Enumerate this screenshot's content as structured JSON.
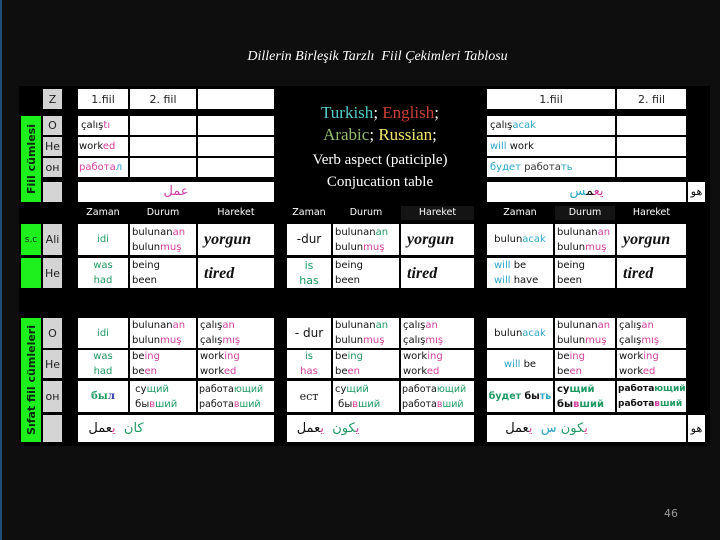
{
  "slide": {
    "title": "Dillerin Birleşik Tarzlı  Fiil Çekimleri Tablosu",
    "page_number": "46"
  },
  "colors": {
    "dark": "#111111",
    "gray": "#333333",
    "pink": "#d33f9e",
    "teal": "#2ea6c9",
    "green": "#1f9a62",
    "blue": "#2535a8",
    "white": "#ffffff",
    "turkish": "#52cccc",
    "english": "#cc4136",
    "arabic": "#94bd6c",
    "russian": "#f3e46c",
    "label_green": "#1ef01e",
    "label_gray": "#d4d4d4"
  },
  "side_labels": {
    "fiil_cumlesi": "Fiil cümlesi",
    "sc": "s.c",
    "sifat_fiil": "Sıfat fiil cümleleri"
  },
  "pronouns": {
    "header": "Z",
    "finite": [
      "O",
      "He",
      "он",
      ""
    ],
    "adjectival": [
      "Ali",
      "He"
    ],
    "participle": [
      "O",
      "He",
      "он",
      ""
    ]
  },
  "legend": {
    "line1": [
      [
        {
          "t": "Turkish",
          "c": "turkish"
        },
        {
          "t": "; ",
          "c": "white"
        },
        {
          "t": "English",
          "c": "english"
        },
        {
          "t": ";",
          "c": "white"
        }
      ]
    ],
    "line2": [
      [
        {
          "t": "Arabic",
          "c": "arabic"
        },
        {
          "t": "; ",
          "c": "white"
        },
        {
          "t": "Russian",
          "c": "russian"
        },
        {
          "t": ";",
          "c": "white"
        }
      ]
    ],
    "line3": "Verb aspect (paticiple)",
    "line4": "Conjucation table"
  },
  "finite": {
    "past": {
      "headers": [
        "1.fiil",
        "2. fiil"
      ],
      "rows": [
        [
          [
            {
              "t": "çalış",
              "c": "dark"
            },
            {
              "t": "tı",
              "c": "pink"
            }
          ]
        ],
        [
          [
            {
              "t": "work",
              "c": "dark"
            },
            {
              "t": "ed",
              "c": "pink"
            }
          ]
        ],
        [
          [
            {
              "t": "работа",
              "c": "pink"
            },
            {
              "t": "л",
              "c": "teal"
            }
          ]
        ]
      ],
      "arabic": [
        [
          {
            "t": "عمل",
            "c": "pink"
          }
        ]
      ]
    },
    "future": {
      "headers": [
        "1.fiil",
        "2. fiil"
      ],
      "rows": [
        [
          [
            {
              "t": "çalış",
              "c": "dark"
            },
            {
              "t": "acak",
              "c": "teal"
            }
          ]
        ],
        [
          [
            {
              "t": "will",
              "c": "teal"
            },
            {
              "t": " work",
              "c": "dark"
            }
          ]
        ],
        [
          [
            {
              "t": "будет",
              "c": "teal"
            },
            {
              "t": " работа",
              "c": "gray"
            },
            {
              "t": "ть",
              "c": "teal"
            }
          ]
        ]
      ],
      "arabic": [
        [
          {
            "t": "يع",
            "c": "pink"
          },
          {
            "t": "م",
            "c": "dark"
          },
          {
            "t": "س",
            "c": "teal"
          }
        ]
      ],
      "pronoun_ar": "هو"
    }
  },
  "column_headers": [
    "Zaman",
    "Durum",
    "Hareket"
  ],
  "adjectival": {
    "past": [
      {
        "zaman": [
          [
            {
              "t": "idi",
              "c": "green"
            }
          ]
        ],
        "durum": [
          [
            {
              "t": "bulunan",
              "c": "dark"
            },
            {
              "t": "an",
              "c": "pink"
            }
          ],
          [
            {
              "t": "bulun",
              "c": "dark"
            },
            {
              "t": "muş",
              "c": "pink"
            }
          ]
        ],
        "hareket": [
          [
            {
              "t": "yorgun",
              "c": "dark"
            }
          ]
        ]
      },
      {
        "zaman": [
          [
            {
              "t": "was",
              "c": "green"
            }
          ],
          [
            {
              "t": "had",
              "c": "green"
            }
          ]
        ],
        "durum": [
          [
            {
              "t": "being",
              "c": "dark"
            }
          ],
          [
            {
              "t": "been",
              "c": "dark"
            }
          ]
        ],
        "hareket": [
          [
            {
              "t": "tired",
              "c": "dark"
            }
          ]
        ]
      }
    ],
    "present": [
      {
        "zaman": [
          [
            {
              "t": "-dur",
              "c": "dark"
            }
          ]
        ],
        "durum": [
          [
            {
              "t": "bulunan",
              "c": "dark"
            },
            {
              "t": "an",
              "c": "green"
            }
          ],
          [
            {
              "t": "bulun",
              "c": "dark"
            },
            {
              "t": "muş",
              "c": "pink"
            }
          ]
        ],
        "hareket": [
          [
            {
              "t": "yorgun",
              "c": "dark"
            }
          ]
        ]
      },
      {
        "zaman": [
          [
            {
              "t": "is",
              "c": "green"
            }
          ],
          [
            {
              "t": "has",
              "c": "green"
            }
          ]
        ],
        "durum": [
          [
            {
              "t": "being",
              "c": "dark"
            }
          ],
          [
            {
              "t": "been",
              "c": "dark"
            }
          ]
        ],
        "hareket": [
          [
            {
              "t": "tired",
              "c": "dark"
            }
          ]
        ]
      }
    ],
    "future": [
      {
        "zaman": [
          [
            {
              "t": "bulun",
              "c": "dark"
            },
            {
              "t": "acak",
              "c": "teal"
            }
          ]
        ],
        "durum": [
          [
            {
              "t": "bulunan",
              "c": "dark"
            },
            {
              "t": "an",
              "c": "pink"
            }
          ],
          [
            {
              "t": "bulun",
              "c": "dark"
            },
            {
              "t": "muş",
              "c": "pink"
            }
          ]
        ],
        "hareket": [
          [
            {
              "t": "yorgun",
              "c": "dark"
            }
          ]
        ]
      },
      {
        "zaman": [
          [
            {
              "t": "will",
              "c": "teal"
            },
            {
              "t": " be",
              "c": "dark"
            }
          ],
          [
            {
              "t": "will",
              "c": "teal"
            },
            {
              "t": " have",
              "c": "dark"
            }
          ]
        ],
        "durum": [
          [
            {
              "t": "being",
              "c": "dark"
            }
          ],
          [
            {
              "t": "been",
              "c": "dark"
            }
          ]
        ],
        "hareket": [
          [
            {
              "t": "tired",
              "c": "dark"
            }
          ]
        ]
      }
    ]
  },
  "participle": {
    "past": [
      {
        "zaman": [
          [
            {
              "t": "idi",
              "c": "green"
            }
          ]
        ],
        "durum": [
          [
            {
              "t": "bulunan",
              "c": "dark"
            },
            {
              "t": "an",
              "c": "pink"
            }
          ],
          [
            {
              "t": "bulun",
              "c": "dark"
            },
            {
              "t": "muş",
              "c": "pink"
            }
          ]
        ],
        "hareket": [
          [
            {
              "t": "çalış",
              "c": "dark"
            },
            {
              "t": "an",
              "c": "pink"
            }
          ],
          [
            {
              "t": "çalış",
              "c": "dark"
            },
            {
              "t": "mış",
              "c": "pink"
            }
          ]
        ]
      },
      {
        "zaman": [
          [
            {
              "t": "was",
              "c": "green"
            }
          ],
          [
            {
              "t": "had",
              "c": "green"
            }
          ]
        ],
        "durum": [
          [
            {
              "t": "be",
              "c": "dark"
            },
            {
              "t": "ing",
              "c": "pink"
            }
          ],
          [
            {
              "t": "be",
              "c": "dark"
            },
            {
              "t": "en",
              "c": "pink"
            }
          ]
        ],
        "hareket": [
          [
            {
              "t": "work",
              "c": "dark"
            },
            {
              "t": "ing",
              "c": "pink"
            }
          ],
          [
            {
              "t": "work",
              "c": "dark"
            },
            {
              "t": "ed",
              "c": "pink"
            }
          ]
        ]
      },
      {
        "zaman": [
          [
            {
              "t": "бы",
              "c": "green"
            },
            {
              "t": "л",
              "c": "blue"
            }
          ]
        ],
        "durum": [
          [
            {
              "t": " су",
              "c": "dark"
            },
            {
              "t": "щий",
              "c": "green"
            }
          ],
          [
            {
              "t": " бы",
              "c": "dark"
            },
            {
              "t": "в",
              "c": "pink"
            },
            {
              "t": "ший",
              "c": "green"
            }
          ]
        ],
        "hareket": [
          [
            {
              "t": "работа",
              "c": "dark"
            },
            {
              "t": "ющий",
              "c": "green"
            }
          ],
          [
            {
              "t": "работа",
              "c": "dark"
            },
            {
              "t": "в",
              "c": "pink"
            },
            {
              "t": "ший",
              "c": "green"
            }
          ]
        ]
      }
    ],
    "present": [
      {
        "zaman": [
          [
            {
              "t": "- dur",
              "c": "dark"
            }
          ]
        ],
        "durum": [
          [
            {
              "t": "bulunan",
              "c": "dark"
            },
            {
              "t": "an",
              "c": "green"
            }
          ],
          [
            {
              "t": "bulun",
              "c": "dark"
            },
            {
              "t": "muş",
              "c": "pink"
            }
          ]
        ],
        "hareket": [
          [
            {
              "t": "çalış",
              "c": "dark"
            },
            {
              "t": "an",
              "c": "pink"
            }
          ],
          [
            {
              "t": "çalış",
              "c": "dark"
            },
            {
              "t": "mış",
              "c": "pink"
            }
          ]
        ]
      },
      {
        "zaman": [
          [
            {
              "t": "is",
              "c": "green"
            }
          ],
          [
            {
              "t": "has",
              "c": "pink"
            }
          ]
        ],
        "durum": [
          [
            {
              "t": "be",
              "c": "dark"
            },
            {
              "t": "ing",
              "c": "green"
            }
          ],
          [
            {
              "t": "be",
              "c": "dark"
            },
            {
              "t": "en",
              "c": "pink"
            }
          ]
        ],
        "hareket": [
          [
            {
              "t": "work",
              "c": "dark"
            },
            {
              "t": "ing",
              "c": "pink"
            }
          ],
          [
            {
              "t": "work",
              "c": "dark"
            },
            {
              "t": "ed",
              "c": "pink"
            }
          ]
        ]
      },
      {
        "zaman": [
          [
            {
              "t": "ест",
              "c": "dark"
            }
          ]
        ],
        "durum": [
          [
            {
              "t": "су",
              "c": "dark"
            },
            {
              "t": "щий",
              "c": "green"
            }
          ],
          [
            {
              "t": " бы",
              "c": "dark"
            },
            {
              "t": "в",
              "c": "pink"
            },
            {
              "t": "ший",
              "c": "green"
            }
          ]
        ],
        "hareket": [
          [
            {
              "t": "работа",
              "c": "dark"
            },
            {
              "t": "ющий",
              "c": "green"
            }
          ],
          [
            {
              "t": "работа",
              "c": "dark"
            },
            {
              "t": "в",
              "c": "pink"
            },
            {
              "t": "ший",
              "c": "green"
            }
          ]
        ]
      }
    ],
    "future": [
      {
        "zaman": [
          [
            {
              "t": "bulun",
              "c": "dark"
            },
            {
              "t": "acak",
              "c": "teal"
            }
          ]
        ],
        "durum": [
          [
            {
              "t": "bulunan",
              "c": "dark"
            },
            {
              "t": "an",
              "c": "pink"
            }
          ],
          [
            {
              "t": "bulun",
              "c": "dark"
            },
            {
              "t": "muş",
              "c": "pink"
            }
          ]
        ],
        "hareket": [
          [
            {
              "t": "çalış",
              "c": "dark"
            },
            {
              "t": "an",
              "c": "pink"
            }
          ],
          [
            {
              "t": "çalış",
              "c": "dark"
            },
            {
              "t": "mış",
              "c": "pink"
            }
          ]
        ]
      },
      {
        "zaman": [
          [
            {
              "t": "will",
              "c": "teal"
            },
            {
              "t": " be",
              "c": "dark"
            }
          ]
        ],
        "durum": [
          [
            {
              "t": "be",
              "c": "dark"
            },
            {
              "t": "ing",
              "c": "pink"
            }
          ],
          [
            {
              "t": "be",
              "c": "dark"
            },
            {
              "t": "en",
              "c": "pink"
            }
          ]
        ],
        "hareket": [
          [
            {
              "t": "work",
              "c": "dark"
            },
            {
              "t": "ing",
              "c": "pink"
            }
          ],
          [
            {
              "t": "work",
              "c": "dark"
            },
            {
              "t": "ed",
              "c": "pink"
            }
          ]
        ]
      },
      {
        "zaman": [
          [
            {
              "t": "будет",
              "c": "green"
            },
            {
              "t": " бы",
              "c": "dark"
            },
            {
              "t": "ть",
              "c": "teal"
            }
          ]
        ],
        "durum": [
          [
            {
              "t": "су",
              "c": "dark"
            },
            {
              "t": "щий",
              "c": "green"
            }
          ],
          [
            {
              "t": "бы",
              "c": "dark"
            },
            {
              "t": "в",
              "c": "pink"
            },
            {
              "t": "ший",
              "c": "green"
            }
          ]
        ],
        "hareket": [
          [
            {
              "t": "работа",
              "c": "dark"
            },
            {
              "t": "ющий",
              "c": "green"
            }
          ],
          [
            {
              "t": "работа",
              "c": "dark"
            },
            {
              "t": "в",
              "c": "pink"
            },
            {
              "t": "ший",
              "c": "green"
            }
          ]
        ]
      }
    ],
    "arabic": {
      "past": [
        [
          {
            "t": "كان",
            "c": "green"
          },
          {
            "t": "  ",
            "c": "dark"
          },
          {
            "t": "ي",
            "c": "pink"
          },
          {
            "t": "عمل",
            "c": "dark"
          }
        ]
      ],
      "present": [
        [
          {
            "t": "ي",
            "c": "pink"
          },
          {
            "t": "كون",
            "c": "green"
          },
          {
            "t": "  ",
            "c": "dark"
          },
          {
            "t": "ي",
            "c": "pink"
          },
          {
            "t": "عمل",
            "c": "dark"
          }
        ]
      ],
      "future": [
        [
          {
            "t": "ي",
            "c": "pink"
          },
          {
            "t": "كون",
            "c": "green"
          },
          {
            "t": " ",
            "c": "dark"
          },
          {
            "t": "س",
            "c": "teal"
          },
          {
            "t": "  ",
            "c": "dark"
          },
          {
            "t": "ي",
            "c": "pink"
          },
          {
            "t": "عمل",
            "c": "dark"
          }
        ]
      ],
      "pronoun_ar": "هو"
    }
  }
}
